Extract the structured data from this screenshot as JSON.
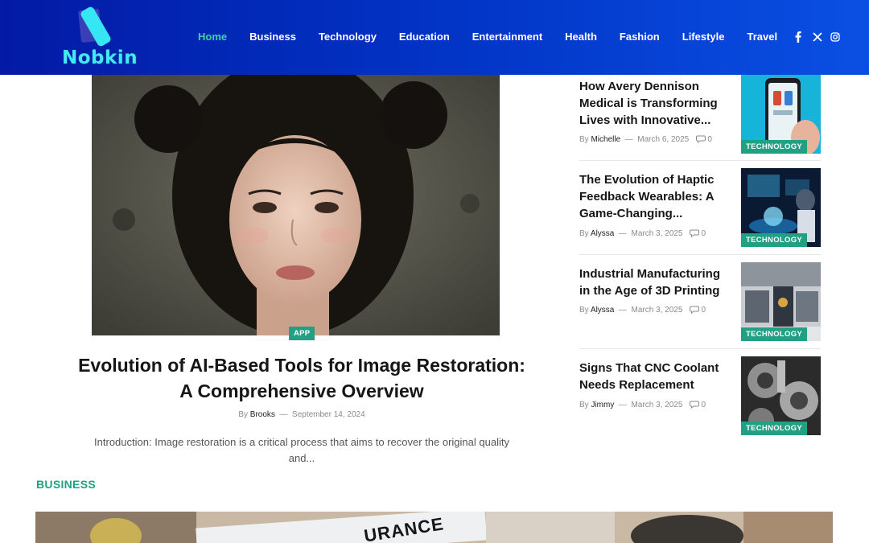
{
  "header": {
    "logo_text": "Nobkin",
    "nav": [
      {
        "label": "Home",
        "active": true
      },
      {
        "label": "Business"
      },
      {
        "label": "Technology"
      },
      {
        "label": "Education"
      },
      {
        "label": "Entertainment"
      },
      {
        "label": "Health"
      },
      {
        "label": "Fashion"
      },
      {
        "label": "Lifestyle"
      },
      {
        "label": "Travel"
      }
    ],
    "social_icons": [
      "facebook-icon",
      "x-icon",
      "instagram-icon"
    ]
  },
  "featured": {
    "category": "APP",
    "title": "Evolution of AI-Based Tools for Image Restoration: A Comprehensive Overview",
    "by": "By",
    "author": "Brooks",
    "sep": "—",
    "date": "September 14, 2024",
    "excerpt": "Introduction: Image restoration is a critical process that aims to recover the original quality and..."
  },
  "sidebar_posts": [
    {
      "title": "How Avery Dennison Medical is Transforming Lives with Innovative...",
      "by": "By",
      "author": "Michelle",
      "sep": "—",
      "date": "March 6, 2025",
      "comments": "0",
      "category": "TECHNOLOGY"
    },
    {
      "title": "The Evolution of Haptic Feedback Wearables: A Game-Changing...",
      "by": "By",
      "author": "Alyssa",
      "sep": "—",
      "date": "March 3, 2025",
      "comments": "0",
      "category": "TECHNOLOGY"
    },
    {
      "title": "Industrial Manufacturing in the Age of 3D Printing",
      "by": "By",
      "author": "Alyssa",
      "sep": "—",
      "date": "March 3, 2025",
      "comments": "0",
      "category": "TECHNOLOGY"
    },
    {
      "title": "Signs That CNC Coolant Needs Replacement",
      "by": "By",
      "author": "Jimmy",
      "sep": "—",
      "date": "March 3, 2025",
      "comments": "0",
      "category": "TECHNOLOGY"
    }
  ],
  "business_section": {
    "title": "BUSINESS",
    "image_text": "URANCE"
  },
  "colors": {
    "header_start": "#031aa5",
    "header_end": "#0a4fe3",
    "accent": "#21a083",
    "nav_active": "#3fd0b0",
    "logo": "#43e9f6"
  }
}
